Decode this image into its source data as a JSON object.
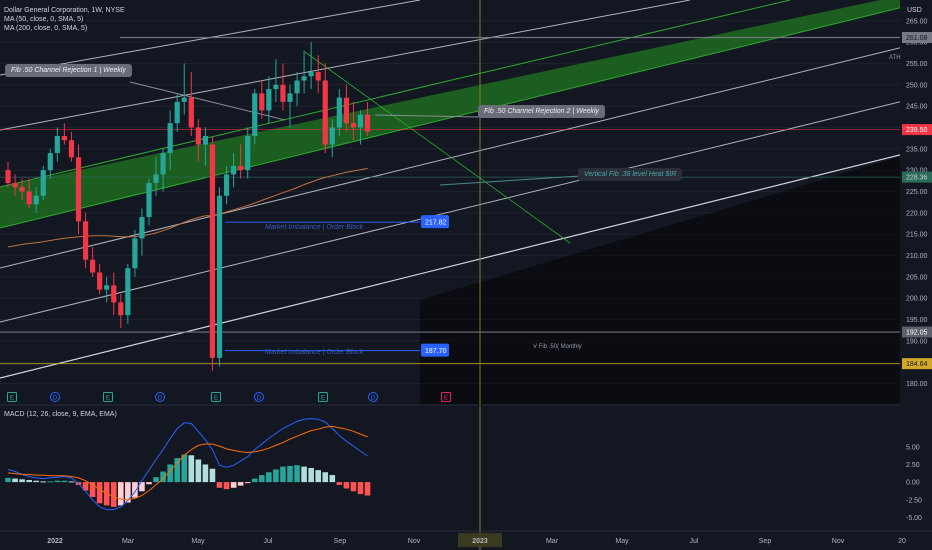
{
  "header": {
    "title": "Dollar General Corporation, 1W, NYSE",
    "ma50": "MA (50, close, 0, SMA, 5)",
    "ma200": "MA (200, close, 0, SMA, 5)",
    "currency": "USD"
  },
  "annotations": {
    "fib_rejection_1": "Fib .50 Channel Rejection 1 | Weekly",
    "fib_rejection_2": "Fib .50 Channel Rejection 2 | Weekly",
    "vertical_fib": "Vertical Fib .38 level Heat $IR",
    "ob_upper": "Market Imbalance | Order Block",
    "ob_lower": "Market Imbalance | Order Block",
    "fib_monthly": "V Fib .50( Monthly",
    "ath": "ATH"
  },
  "macd": {
    "title": "MACD (12, 26, close, 9, EMA, EMA)"
  },
  "price_tags": [
    {
      "value": "261.08",
      "color": "#787b86",
      "text_color": "#131722"
    },
    {
      "value": "239.50",
      "color": "#f23645",
      "text_color": "#ffffff"
    },
    {
      "value": "228.36",
      "color": "#2a6b5a",
      "text_color": "#d1d4dc"
    },
    {
      "value": "192.05",
      "color": "#5d606b",
      "text_color": "#ffffff"
    },
    {
      "value": "184.64",
      "color": "#d4a82a",
      "text_color": "#131722"
    }
  ],
  "ob_boxes": [
    {
      "label": "217.82",
      "price": 217.82
    },
    {
      "label": "187.70",
      "price": 187.7
    }
  ],
  "event_markers": [
    {
      "letter": "E",
      "color": "#26a69a",
      "kind": "square"
    },
    {
      "letter": "D",
      "color": "#2962ff",
      "kind": "circle"
    },
    {
      "letter": "E",
      "color": "#26a69a",
      "kind": "square"
    },
    {
      "letter": "D",
      "color": "#2962ff",
      "kind": "circle"
    },
    {
      "letter": "E",
      "color": "#26a69a",
      "kind": "square"
    },
    {
      "letter": "D",
      "color": "#2962ff",
      "kind": "circle"
    },
    {
      "letter": "E",
      "color": "#26a69a",
      "kind": "square"
    },
    {
      "letter": "D",
      "color": "#2962ff",
      "kind": "circle"
    },
    {
      "letter": "E",
      "color": "#e91e63",
      "kind": "square"
    }
  ],
  "colors": {
    "background": "#131722",
    "up": "#26a69a",
    "down": "#f23645",
    "ma50": "#c46f3f",
    "ma200": "#e65100",
    "macd_line": "#2962ff",
    "signal_line": "#ff6d00",
    "channel_fill": "#1e7a1e"
  },
  "chart_data": {
    "type": "candlestick",
    "title": "Dollar General Corporation, 1W, NYSE",
    "ylim": [
      178,
      268
    ],
    "y_ticks": [
      "265.00",
      "260.00",
      "255.00",
      "250.00",
      "245.00",
      "240.00",
      "235.00",
      "230.00",
      "225.00",
      "220.00",
      "215.00",
      "210.00",
      "205.00",
      "200.00",
      "195.00",
      "190.00",
      "185.00",
      "180.00"
    ],
    "x_ticks": [
      "2022",
      "Mar",
      "May",
      "Jul",
      "Sep",
      "Nov",
      "2023",
      "Mar",
      "May",
      "Jul",
      "Sep",
      "Nov",
      "20"
    ],
    "candles": [
      [
        230,
        232,
        226,
        227
      ],
      [
        227,
        229,
        224,
        226
      ],
      [
        226,
        228,
        223,
        225
      ],
      [
        225,
        228,
        221,
        222
      ],
      [
        222,
        226,
        220,
        224
      ],
      [
        224,
        231,
        223,
        230
      ],
      [
        230,
        235,
        228,
        234
      ],
      [
        234,
        240,
        232,
        238
      ],
      [
        238,
        241,
        236,
        237
      ],
      [
        237,
        239,
        232,
        233
      ],
      [
        233,
        236,
        215,
        218
      ],
      [
        218,
        220,
        207,
        209
      ],
      [
        209,
        212,
        205,
        206
      ],
      [
        206,
        208,
        201,
        202
      ],
      [
        202,
        205,
        199,
        203
      ],
      [
        203,
        206,
        196,
        199
      ],
      [
        199,
        201,
        193,
        196
      ],
      [
        196,
        208,
        194,
        207
      ],
      [
        207,
        216,
        205,
        214
      ],
      [
        214,
        221,
        210,
        219
      ],
      [
        219,
        228,
        217,
        227
      ],
      [
        227,
        233,
        224,
        229
      ],
      [
        229,
        235,
        225,
        234
      ],
      [
        234,
        244,
        230,
        241
      ],
      [
        241,
        248,
        239,
        246
      ],
      [
        246,
        255,
        243,
        247
      ],
      [
        247,
        253,
        238,
        240
      ],
      [
        240,
        242,
        232,
        236
      ],
      [
        236,
        240,
        231,
        238
      ],
      [
        236,
        238,
        183,
        186
      ],
      [
        186,
        226,
        184,
        224
      ],
      [
        224,
        231,
        222,
        229
      ],
      [
        229,
        234,
        226,
        231
      ],
      [
        231,
        236,
        228,
        230
      ],
      [
        230,
        240,
        228,
        238
      ],
      [
        238,
        249,
        236,
        248
      ],
      [
        248,
        251,
        242,
        244
      ],
      [
        244,
        252,
        241,
        249
      ],
      [
        249,
        256,
        246,
        250
      ],
      [
        250,
        255,
        244,
        246
      ],
      [
        246,
        250,
        240,
        248
      ],
      [
        248,
        253,
        245,
        251
      ],
      [
        251,
        258,
        248,
        252
      ],
      [
        252,
        260,
        249,
        253
      ],
      [
        253,
        257,
        248,
        251
      ],
      [
        251,
        255,
        234,
        236
      ],
      [
        236,
        242,
        233,
        240
      ],
      [
        240,
        249,
        238,
        247
      ],
      [
        247,
        250,
        239,
        241
      ],
      [
        241,
        246,
        237,
        240
      ],
      [
        240,
        244,
        236,
        243
      ],
      [
        243,
        246,
        238,
        239
      ]
    ],
    "macd_ylim": [
      -6.5,
      10.5
    ],
    "macd_ticks": [
      "5.00",
      "2.50",
      "0.00",
      "-2.50",
      "-5.00"
    ],
    "macd_hist": [
      0.6,
      0.5,
      0.4,
      0.3,
      0.2,
      0.1,
      0.1,
      0.2,
      0.2,
      0.1,
      -0.4,
      -1.2,
      -2.1,
      -3.0,
      -3.3,
      -3.5,
      -3.3,
      -2.9,
      -2.2,
      -1.3,
      -0.3,
      0.7,
      1.5,
      2.5,
      3.4,
      3.9,
      3.8,
      3.2,
      2.5,
      1.9,
      -0.8,
      -1.0,
      -0.8,
      -0.5,
      -0.1,
      0.5,
      1.0,
      1.4,
      1.8,
      2.2,
      2.3,
      2.4,
      2.2,
      2.0,
      1.7,
      1.4,
      1.0,
      -0.4,
      -0.9,
      -1.3,
      -1.7,
      -1.9
    ],
    "macd_line": [
      1.8,
      1.5,
      1.1,
      0.8,
      0.6,
      0.5,
      0.6,
      0.7,
      0.8,
      0.6,
      -0.2,
      -1.3,
      -2.5,
      -3.5,
      -3.9,
      -3.9,
      -3.5,
      -2.6,
      -1.4,
      0.2,
      1.7,
      3.2,
      4.6,
      6.2,
      7.6,
      8.4,
      8.3,
      7.2,
      6.0,
      4.6,
      2.4,
      2.1,
      2.4,
      3.0,
      3.6,
      4.6,
      5.4,
      6.2,
      6.9,
      7.6,
      8.1,
      8.6,
      8.9,
      9.0,
      8.9,
      8.5,
      7.6,
      6.6,
      5.8,
      5.1,
      4.4,
      3.7
    ],
    "signal_line": [
      1.3,
      1.2,
      1.1,
      1.1,
      1.0,
      1.0,
      0.9,
      0.9,
      0.9,
      0.8,
      0.6,
      0.2,
      -0.4,
      -1.0,
      -1.6,
      -2.1,
      -2.4,
      -2.5,
      -2.3,
      -1.9,
      -1.2,
      -0.4,
      0.5,
      1.6,
      2.7,
      3.8,
      4.6,
      5.2,
      5.4,
      5.4,
      5.1,
      4.7,
      4.5,
      4.3,
      4.2,
      4.3,
      4.5,
      4.8,
      5.2,
      5.6,
      6.1,
      6.5,
      6.9,
      7.3,
      7.5,
      7.8,
      7.9,
      7.7,
      7.5,
      7.2,
      6.8,
      6.4
    ],
    "ma50": [
      212,
      212.3,
      212.6,
      212.8,
      213,
      213.2,
      213.5,
      213.8,
      214,
      214.2,
      214.4,
      214.5,
      214.6,
      214.6,
      214.6,
      214.5,
      214.4,
      214.4,
      214.4,
      214.6,
      214.9,
      215.3,
      215.8,
      216.4,
      217.1,
      217.8,
      218.4,
      218.9,
      219.3,
      219.3,
      219.7,
      220.2,
      220.7,
      221.2,
      221.7,
      222.3,
      222.9,
      223.5,
      224.1,
      224.7,
      225.3,
      225.9,
      226.6,
      227.2,
      227.8,
      228.3,
      228.7,
      229.1,
      229.5,
      229.8,
      230.1,
      230.4
    ]
  }
}
